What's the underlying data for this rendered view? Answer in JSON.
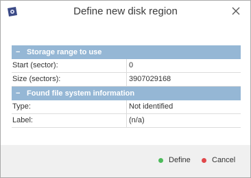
{
  "window": {
    "title": "Define new disk region"
  },
  "sections": [
    {
      "title": "Storage range to use",
      "toggle": "−",
      "rows": [
        {
          "label": "Start (sector):",
          "value": "0"
        },
        {
          "label": "Size (sectors):",
          "value": "3907029168"
        }
      ]
    },
    {
      "title": "Found file system information",
      "toggle": "−",
      "rows": [
        {
          "label": "Type:",
          "value": "Not identified"
        },
        {
          "label": "Label:",
          "value": "(n/a)"
        }
      ]
    }
  ],
  "buttons": {
    "define": {
      "label": "Define",
      "color": "#4cba5a"
    },
    "cancel": {
      "label": "Cancel",
      "color": "#e0474a"
    }
  },
  "icons": {
    "app": "app-logo-icon",
    "close": "close-icon"
  }
}
